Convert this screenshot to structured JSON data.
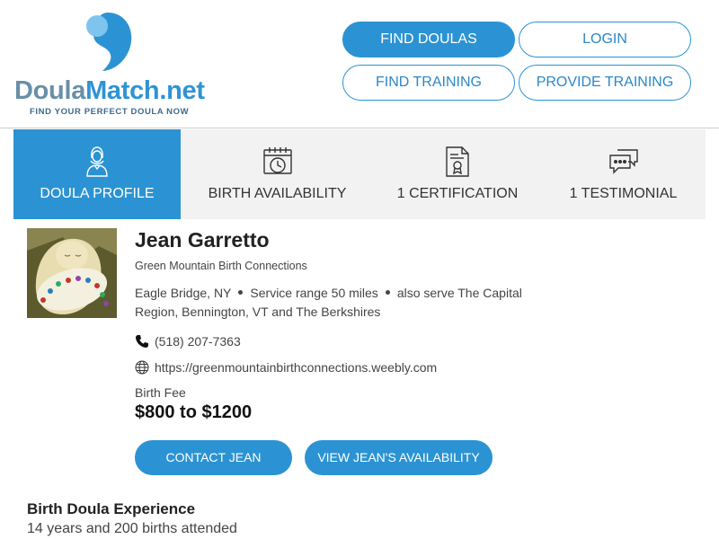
{
  "logo": {
    "part1": "Doula",
    "part2": "Match.net",
    "tagline": "FIND YOUR PERFECT DOULA NOW"
  },
  "nav": {
    "find_doulas": "FIND DOULAS",
    "login": "LOGIN",
    "find_training": "FIND TRAINING",
    "provide_training": "PROVIDE TRAINING"
  },
  "tabs": [
    {
      "label": "DOULA PROFILE",
      "icon": "doula-person-icon",
      "active": true
    },
    {
      "label": "BIRTH AVAILABILITY",
      "icon": "calendar-clock-icon",
      "active": false
    },
    {
      "label": "1 CERTIFICATION",
      "icon": "certificate-icon",
      "active": false
    },
    {
      "label": "1 TESTIMONIAL",
      "icon": "speech-bubbles-icon",
      "active": false
    }
  ],
  "profile": {
    "name": "Jean Garretto",
    "organization": "Green Mountain Birth Connections",
    "location": "Eagle Bridge, NY",
    "service_range": "Service range 50 miles",
    "also_serve": "also serve The Capital Region, Bennington, VT and The Berkshires",
    "phone": "(518) 207-7363",
    "website": "https://greenmountainbirthconnections.weebly.com",
    "fee_label": "Birth Fee",
    "fee": "$800 to $1200",
    "contact_button": "CONTACT JEAN",
    "availability_button": "VIEW JEAN'S AVAILABILITY"
  },
  "experience": {
    "title": "Birth Doula Experience",
    "text": "14 years and 200 births attended"
  },
  "colors": {
    "accent": "#2b93d3",
    "tab_background": "#f2f2f2",
    "logo_gray": "#6a8fa8"
  }
}
